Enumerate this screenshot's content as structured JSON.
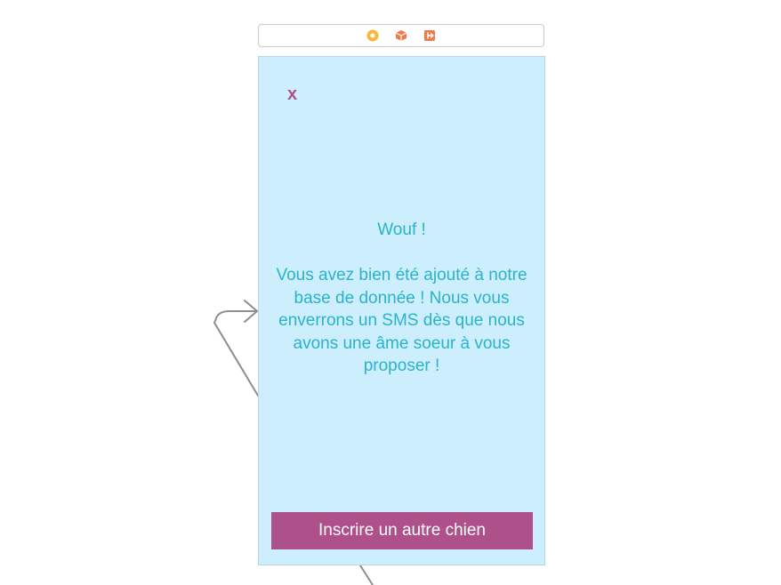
{
  "colors": {
    "screen_background": "#cdeefc",
    "message_text": "#2ab3cb",
    "accent": "#ae5089",
    "button_text": "#ffffff",
    "segue_line": "#8e8e8e",
    "first_responder_icon": "#f6b73c",
    "scene_icon": "#f07a4b"
  },
  "scene_dock": {
    "icons": [
      "view-controller-icon",
      "first-responder-icon",
      "exit-icon"
    ]
  },
  "screen": {
    "close_label": "x",
    "message": "Wouf !\n\nVous avez bien été ajouté à notre base de donnée ! Nous vous enverrons un SMS dès que nous avons une âme soeur à vous proposer !",
    "button_label": "Inscrire un autre chien"
  }
}
